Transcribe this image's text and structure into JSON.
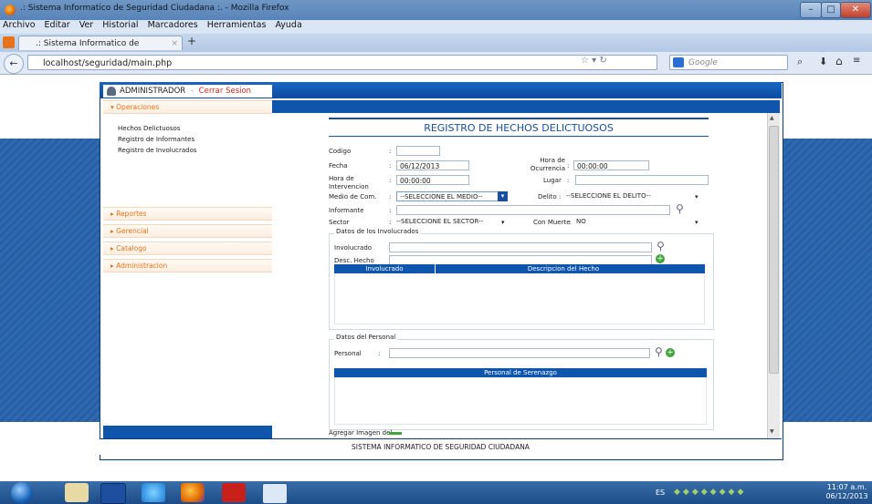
{
  "window": {
    "title": ".: Sistema Informatico de Seguridad Ciudadana :. - Mozilla Firefox"
  },
  "menu": [
    "Archivo",
    "Editar",
    "Ver",
    "Historial",
    "Marcadores",
    "Herramientas",
    "Ayuda"
  ],
  "tab": {
    "label": ".: Sistema Informatico de Seguridad ...",
    "new_tab": "+"
  },
  "nav": {
    "url": "localhost/seguridad/main.php",
    "search_placeholder": "Google"
  },
  "app": {
    "user": "ADMINISTRADOR",
    "separator": "-",
    "logout": "Cerrar Sesion",
    "footer": "SISTEMA INFORMATICO DE SEGURIDAD CIUDADANA"
  },
  "sidebar": {
    "operaciones": "Operaciones",
    "items": [
      "Hechos Delictuosos",
      "Registro de Informantes",
      "Registro de Involucrados"
    ],
    "sections": [
      "Reportes",
      "Gerencial",
      "Catalogo",
      "Administracion"
    ]
  },
  "form": {
    "title": "REGISTRO DE HECHOS DELICTUOSOS",
    "codigo_label": "Codigo",
    "colon": ":",
    "fecha_label": "Fecha",
    "fecha_value": "06/12/2013",
    "hora_ocurrencia_label": "Hora de Ocurrencia",
    "hora_ocurrencia_value": "00:00:00",
    "hora_intervencion_label": "Hora de Intervencion",
    "hora_intervencion_value": "00:00:00",
    "lugar_label": "Lugar",
    "medio_label": "Medio de Com.",
    "medio_value": "--SELECCIONE EL MEDIO--",
    "delito_label": "Delito",
    "delito_value": "--SELECCIONE EL DELITO--",
    "informante_label": "Informante",
    "sector_label": "Sector",
    "sector_value": "--SELECCIONE EL SECTOR--",
    "con_muerte_label": "Con Muerte",
    "con_muerte_value": "NO",
    "involucrados_legend": "Datos de los Involucrados",
    "involucrado_label": "Involucrado",
    "desc_hecho_label": "Desc. Hecho",
    "inv_col1": "Involucrado",
    "inv_col2": "Descripcion del Hecho",
    "personal_legend": "Datos del Personal",
    "personal_label": "Personal",
    "personal_col": "Personal de Serenazgo",
    "agregar_imagen_label": "Agregar Imagen del"
  },
  "taskbar": {
    "lang": "ES",
    "time": "11:07 a.m.",
    "date": "06/12/2013"
  },
  "colors": {
    "accent": "#0e55ab",
    "orange": "#e8731b",
    "title_blue": "#1a4fa0"
  }
}
